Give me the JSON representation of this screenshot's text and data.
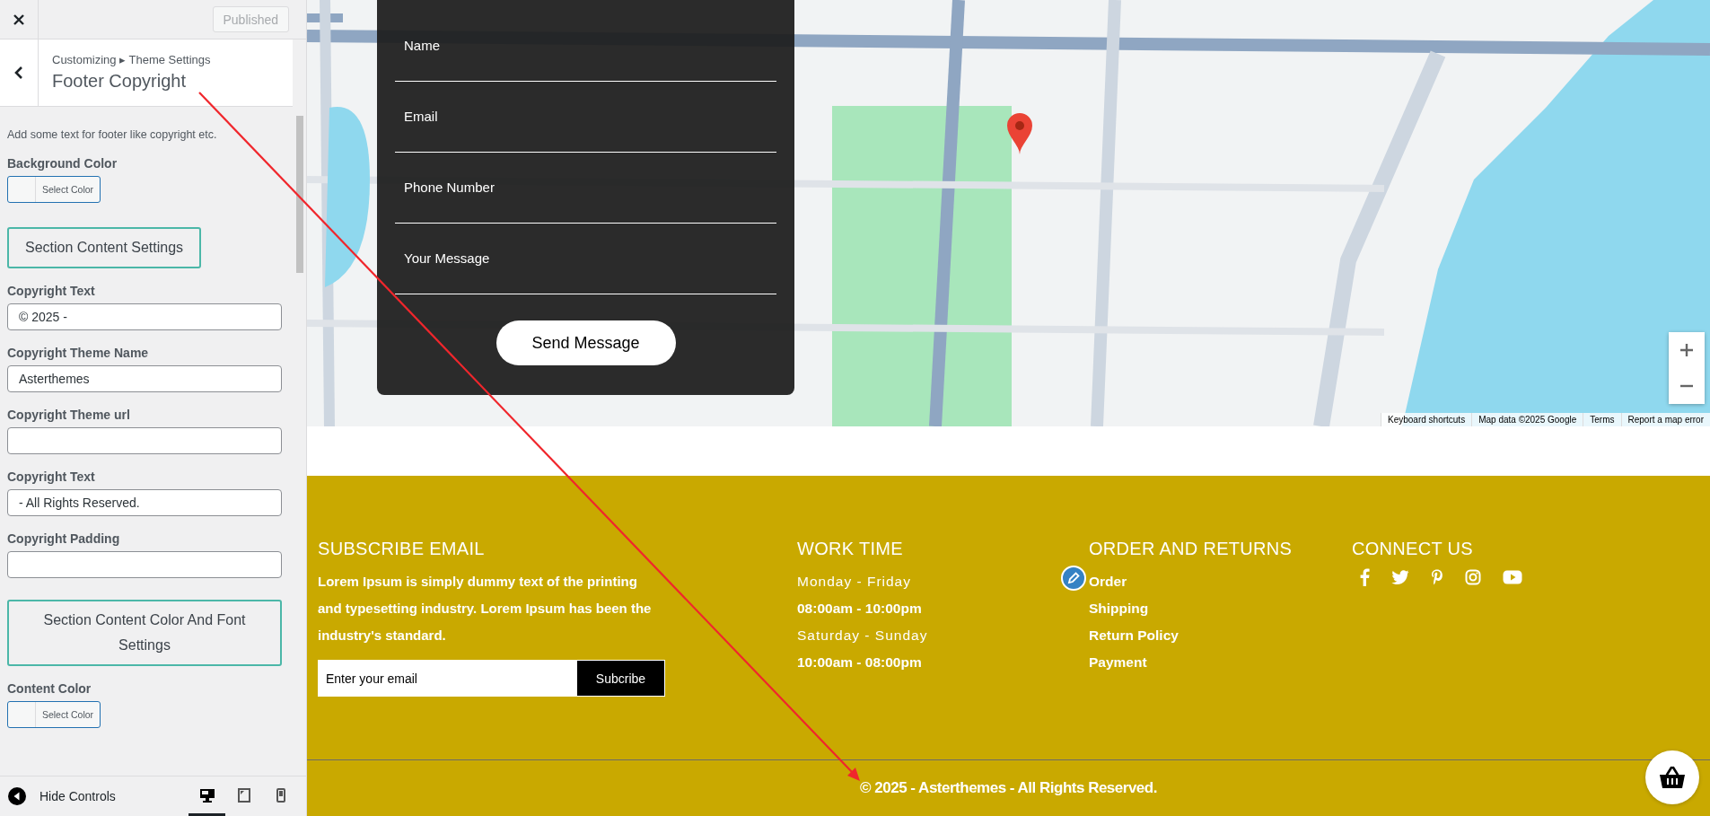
{
  "top_bar": {
    "publish_button": "Published"
  },
  "header": {
    "breadcrumb": "Customizing ▸ Theme Settings",
    "title": "Footer Copyright"
  },
  "description": "Add some text for footer like copyright etc.",
  "controls": [
    {
      "kind": "color",
      "label": "Background Color",
      "button": "Select Color"
    },
    {
      "kind": "section",
      "label": "Section Content Settings"
    },
    {
      "kind": "text",
      "label": "Copyright Text",
      "value": "© 2025 -"
    },
    {
      "kind": "text",
      "label": "Copyright Theme Name",
      "value": "Asterthemes"
    },
    {
      "kind": "text",
      "label": "Copyright Theme url"
    },
    {
      "kind": "text",
      "label": "Copyright Text",
      "value": "- All Rights Reserved."
    },
    {
      "kind": "text",
      "label": "Copyright Padding"
    },
    {
      "kind": "section",
      "label": "Section Content Color And Font Settings"
    },
    {
      "kind": "color",
      "label": "Content Color",
      "button": "Select Color"
    }
  ],
  "bottom_bar": {
    "hide_label": "Hide Controls",
    "devices": [
      {
        "kind": "desktop",
        "selected": true
      },
      {
        "kind": "tablet",
        "selected": false
      },
      {
        "kind": "mobile",
        "selected": false
      }
    ]
  },
  "contact_form": {
    "fields": [
      "Name",
      "Email",
      "Phone Number",
      "Your Message"
    ],
    "submit": "Send Message"
  },
  "map": {
    "attribution": [
      "Keyboard shortcuts",
      "Map data ©2025 Google",
      "Terms",
      "Report a map error"
    ]
  },
  "footer": {
    "subscribe": {
      "title": "SUBSCRIBE EMAIL",
      "text": "Lorem Ipsum is simply dummy text of the printing and typesetting industry. Lorem Ipsum has been the industry's standard.",
      "placeholder": "Enter your email",
      "button": "Subcribe"
    },
    "work_time": {
      "title": "WORK TIME",
      "rows": [
        {
          "kind": "day",
          "text": "Monday - Friday"
        },
        {
          "kind": "hours",
          "text": "08:00am - 10:00pm"
        },
        {
          "kind": "day",
          "text": "Saturday - Sunday"
        },
        {
          "kind": "hours",
          "text": "10:00am - 08:00pm"
        }
      ]
    },
    "orders": {
      "title": "ORDER AND RETURNS",
      "links": [
        "Order",
        "Shipping",
        "Return Policy",
        "Payment"
      ]
    },
    "connect": {
      "title": "CONNECT US",
      "socials": [
        {
          "kind": "facebook"
        },
        {
          "kind": "twitter"
        },
        {
          "kind": "pinterest"
        },
        {
          "kind": "instagram"
        },
        {
          "kind": "youtube"
        }
      ]
    },
    "copyright": "© 2025 -  Asterthemes - All Rights Reserved."
  }
}
